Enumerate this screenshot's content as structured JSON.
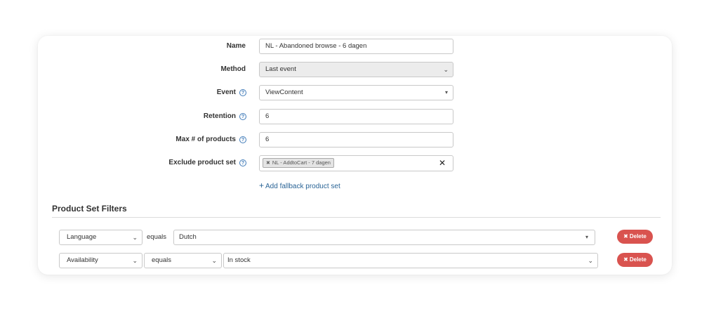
{
  "form": {
    "name": {
      "label": "Name",
      "value": "NL - Abandoned browse - 6 dagen"
    },
    "method": {
      "label": "Method",
      "value": "Last event"
    },
    "event": {
      "label": "Event",
      "value": "ViewContent"
    },
    "retention": {
      "label": "Retention",
      "value": "6"
    },
    "max_products": {
      "label": "Max # of products",
      "value": "6"
    },
    "exclude_product_set": {
      "label": "Exclude product set",
      "tag": "NL - AddtoCart - 7 dagen"
    },
    "add_fallback_label": "Add fallback product set"
  },
  "filters": {
    "title": "Product Set Filters",
    "rows": [
      {
        "field": "Language",
        "operator": "equals",
        "value": "Dutch",
        "delete_label": "Delete"
      },
      {
        "field": "Availability",
        "operator": "equals",
        "value": "In stock",
        "delete_label": "Delete"
      }
    ]
  },
  "icons": {
    "help": "question-circle-icon",
    "remove_tag": "x-icon",
    "clear": "close-icon",
    "add": "plus-icon",
    "delete": "times-icon"
  },
  "colors": {
    "accent_link": "#2a6496",
    "help_icon": "#3f7ab8",
    "delete_button": "#d9534f"
  }
}
